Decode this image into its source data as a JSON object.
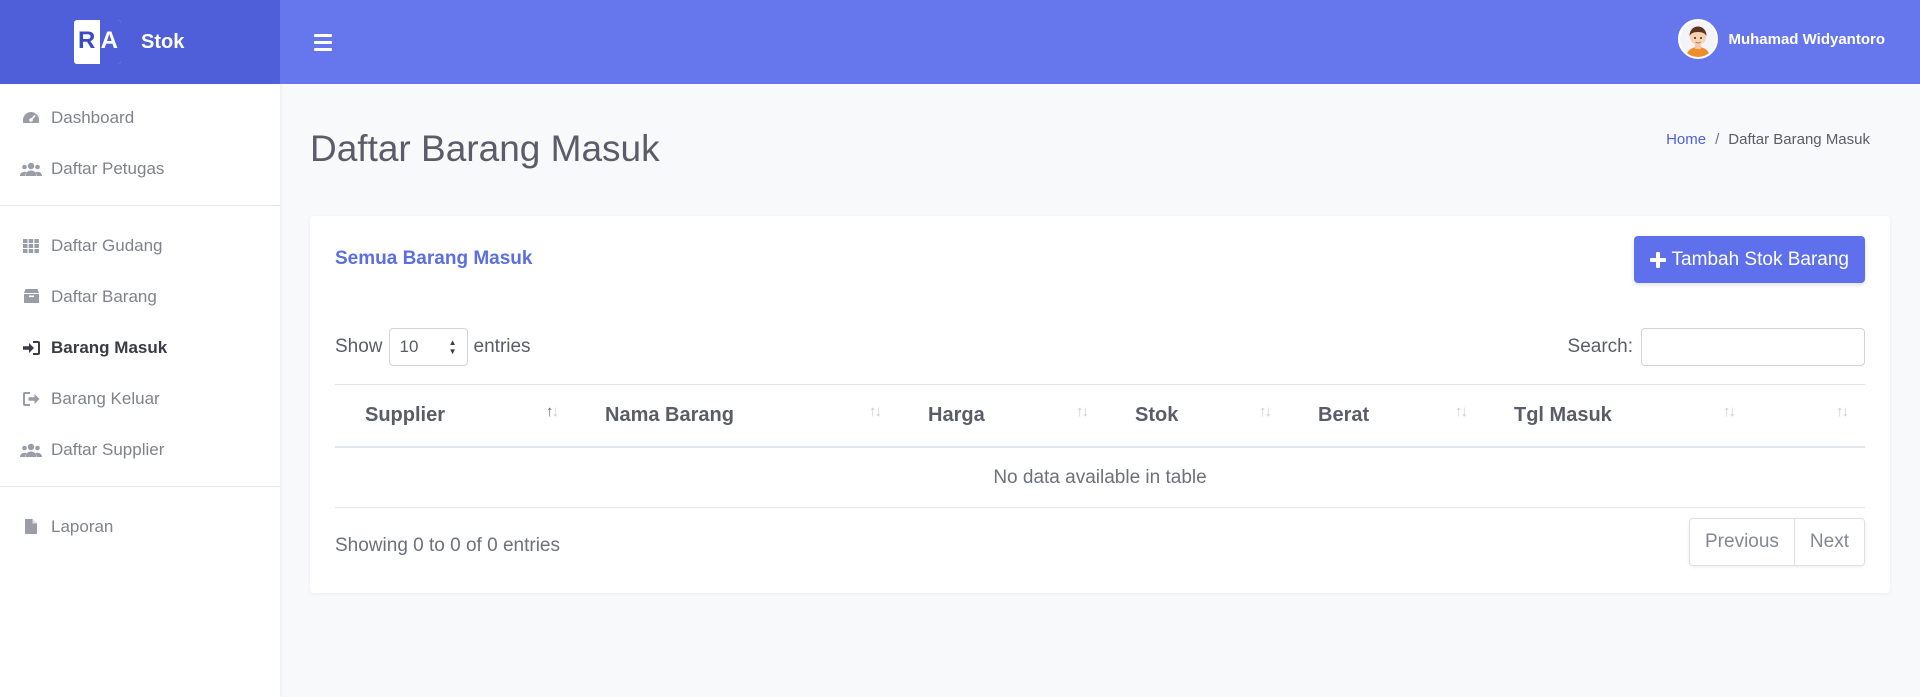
{
  "brand": {
    "logo_text": "RA",
    "name": "Stok"
  },
  "sidebar": {
    "groups": [
      [
        {
          "label": "Dashboard",
          "icon": "tachometer-icon"
        },
        {
          "label": "Daftar Petugas",
          "icon": "users-icon"
        }
      ],
      [
        {
          "label": "Daftar Gudang",
          "icon": "grid-icon"
        },
        {
          "label": "Daftar Barang",
          "icon": "box-icon"
        },
        {
          "label": "Barang Masuk",
          "icon": "sign-in-icon",
          "active": true
        },
        {
          "label": "Barang Keluar",
          "icon": "sign-out-icon"
        },
        {
          "label": "Daftar Supplier",
          "icon": "users-icon"
        }
      ],
      [
        {
          "label": "Laporan",
          "icon": "file-icon"
        }
      ]
    ]
  },
  "topbar": {
    "menu_icon": "hamburger-icon",
    "user_name": "Muhamad Widyantoro"
  },
  "page": {
    "title": "Daftar Barang Masuk",
    "breadcrumb": {
      "home": "Home",
      "separator": "/",
      "current": "Daftar Barang Masuk"
    }
  },
  "card": {
    "title": "Semua Barang Masuk",
    "add_button": "Tambah Stok Barang",
    "show_label": "Show",
    "page_size": "10",
    "entries_label": "entries",
    "search_label": "Search:",
    "search_value": "",
    "columns": [
      "Supplier",
      "Nama Barang",
      "Harga",
      "Stok",
      "Berat",
      "Tgl Masuk",
      ""
    ],
    "empty_text": "No data available in table",
    "info": "Showing 0 to 0 of 0 entries",
    "pagination": {
      "previous": "Previous",
      "next": "Next"
    }
  },
  "colors": {
    "brand": "#4e5fd9",
    "topbar": "#6677ee",
    "primary_button": "#5e70ec",
    "accent_text": "#5b6ee3"
  }
}
